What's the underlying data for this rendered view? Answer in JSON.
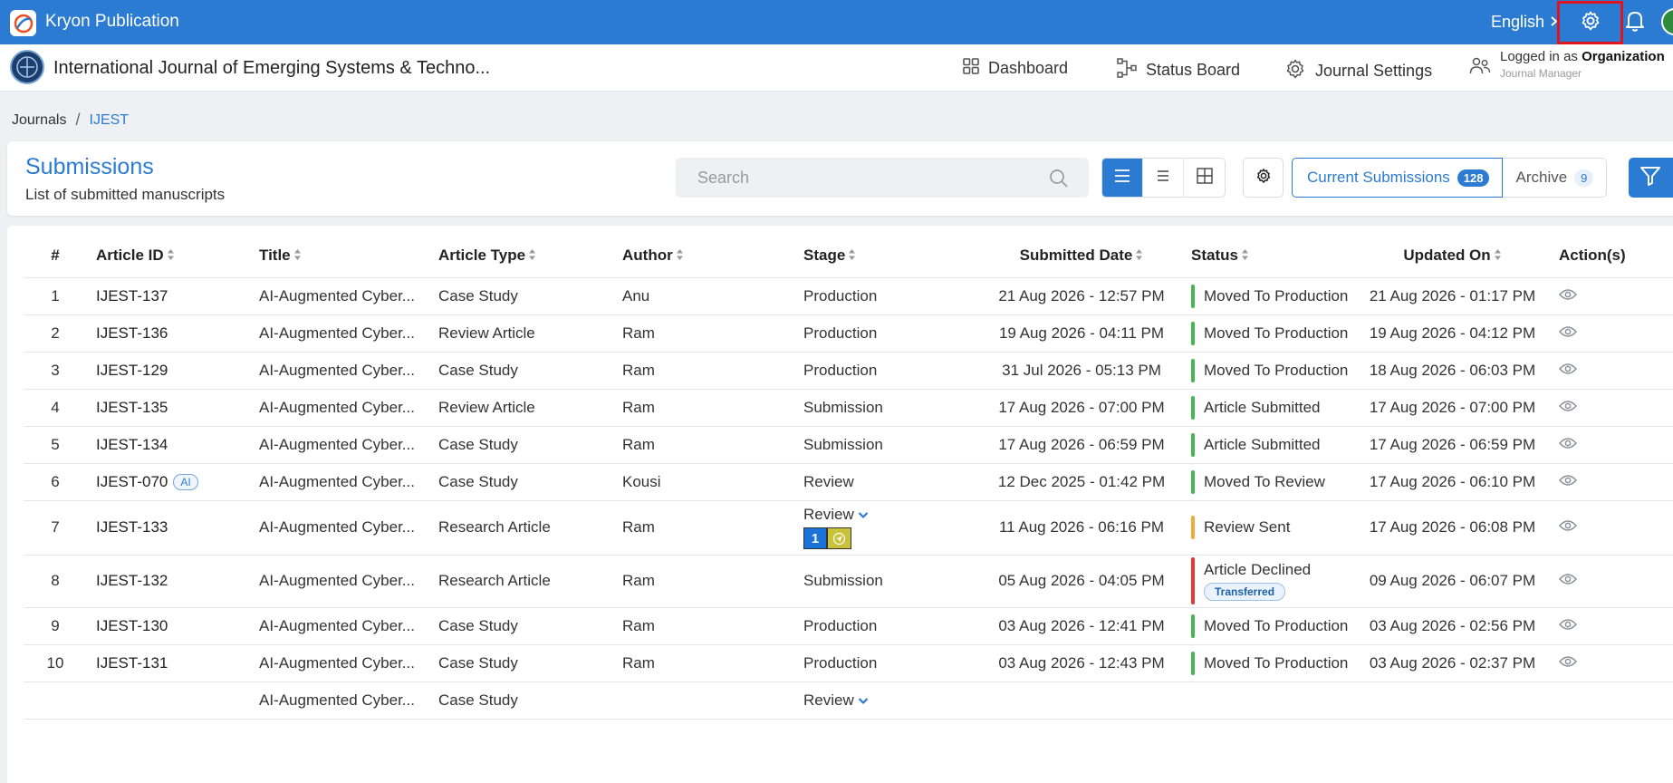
{
  "app": {
    "title": "Kryon Publication",
    "language": "English"
  },
  "journal": {
    "title": "International Journal of Emerging Systems & Techno..."
  },
  "nav": {
    "dashboard": "Dashboard",
    "status_board": "Status Board",
    "journal_settings": "Journal Settings"
  },
  "user": {
    "logged_prefix": "Logged in as",
    "name": "Organization",
    "role": "Journal Manager"
  },
  "breadcrumb": {
    "root": "Journals",
    "current": "IJEST"
  },
  "submissions": {
    "title": "Submissions",
    "description": "List of submitted manuscripts",
    "search_placeholder": "Search",
    "current_label": "Current Submissions",
    "current_count": "128",
    "archive_label": "Archive",
    "archive_count": "9"
  },
  "table": {
    "headers": {
      "num": "#",
      "article_id": "Article ID",
      "title": "Title",
      "article_type": "Article Type",
      "author": "Author",
      "stage": "Stage",
      "submitted_date": "Submitted Date",
      "status": "Status",
      "updated_on": "Updated On",
      "actions": "Action(s)"
    },
    "rows": [
      {
        "num": "1",
        "id": "IJEST-137",
        "title": "AI-Augmented Cyber...",
        "type": "Case Study",
        "author": "Anu",
        "stage": "Production",
        "submitted": "21 Aug 2026 - 12:57 PM",
        "status": "Moved To Production",
        "updated": "21 Aug 2026 - 01:17 PM"
      },
      {
        "num": "2",
        "id": "IJEST-136",
        "title": "AI-Augmented Cyber...",
        "type": "Review Article",
        "author": "Ram",
        "stage": "Production",
        "submitted": "19 Aug 2026 - 04:11 PM",
        "status": "Moved To Production",
        "updated": "19 Aug 2026 - 04:12 PM"
      },
      {
        "num": "3",
        "id": "IJEST-129",
        "title": "AI-Augmented Cyber...",
        "type": "Case Study",
        "author": "Ram",
        "stage": "Production",
        "submitted": "31 Jul 2026 - 05:13 PM",
        "status": "Moved To Production",
        "updated": "18 Aug 2026 - 06:03 PM"
      },
      {
        "num": "4",
        "id": "IJEST-135",
        "title": "AI-Augmented Cyber...",
        "type": "Review Article",
        "author": "Ram",
        "stage": "Submission",
        "submitted": "17 Aug 2026 - 07:00 PM",
        "status": "Article Submitted",
        "updated": "17 Aug 2026 - 07:00 PM"
      },
      {
        "num": "5",
        "id": "IJEST-134",
        "title": "AI-Augmented Cyber...",
        "type": "Case Study",
        "author": "Ram",
        "stage": "Submission",
        "submitted": "17 Aug 2026 - 06:59 PM",
        "status": "Article Submitted",
        "updated": "17 Aug 2026 - 06:59 PM"
      },
      {
        "num": "6",
        "id": "IJEST-070",
        "ai_badge": "AI",
        "title": "AI-Augmented Cyber...",
        "type": "Case Study",
        "author": "Kousi",
        "stage": "Review",
        "submitted": "12 Dec 2025 - 01:42 PM",
        "status": "Moved To Review",
        "updated": "17 Aug 2026 - 06:10 PM"
      },
      {
        "num": "7",
        "id": "IJEST-133",
        "title": "AI-Augmented Cyber...",
        "type": "Research Article",
        "author": "Ram",
        "stage": "Review",
        "review_round": "1",
        "submitted": "11 Aug 2026 - 06:16 PM",
        "status": "Review Sent",
        "updated": "17 Aug 2026 - 06:08 PM"
      },
      {
        "num": "8",
        "id": "IJEST-132",
        "title": "AI-Augmented Cyber...",
        "type": "Research Article",
        "author": "Ram",
        "stage": "Submission",
        "submitted": "05 Aug 2026 - 04:05 PM",
        "status": "Article Declined",
        "status_badge": "Transferred",
        "updated": "09 Aug 2026 - 06:07 PM"
      },
      {
        "num": "9",
        "id": "IJEST-130",
        "title": "AI-Augmented Cyber...",
        "type": "Case Study",
        "author": "Ram",
        "stage": "Production",
        "submitted": "03 Aug 2026 - 12:41 PM",
        "status": "Moved To Production",
        "updated": "03 Aug 2026 - 02:56 PM"
      },
      {
        "num": "10",
        "id": "IJEST-131",
        "title": "AI-Augmented Cyber...",
        "type": "Case Study",
        "author": "Ram",
        "stage": "Production",
        "submitted": "03 Aug 2026 - 12:43 PM",
        "status": "Moved To Production",
        "updated": "03 Aug 2026 - 02:37 PM"
      },
      {
        "num": "",
        "id": "",
        "title": "AI-Augmented Cyber...",
        "type": "Case Study",
        "author": "",
        "stage": "Review",
        "submitted": "",
        "status": "",
        "updated": ""
      }
    ]
  },
  "icons": {
    "settings": "gear-icon",
    "notifications": "bell-icon",
    "dashboard": "grid-icon",
    "status_board": "flow-icon",
    "view": "eye-icon",
    "filter": "filter-icon",
    "search": "search-icon"
  },
  "colors": {
    "primary": "#2c7bd2",
    "status_green": "#45b74f",
    "status_amber": "#f2a93b",
    "status_red": "#e53935"
  }
}
